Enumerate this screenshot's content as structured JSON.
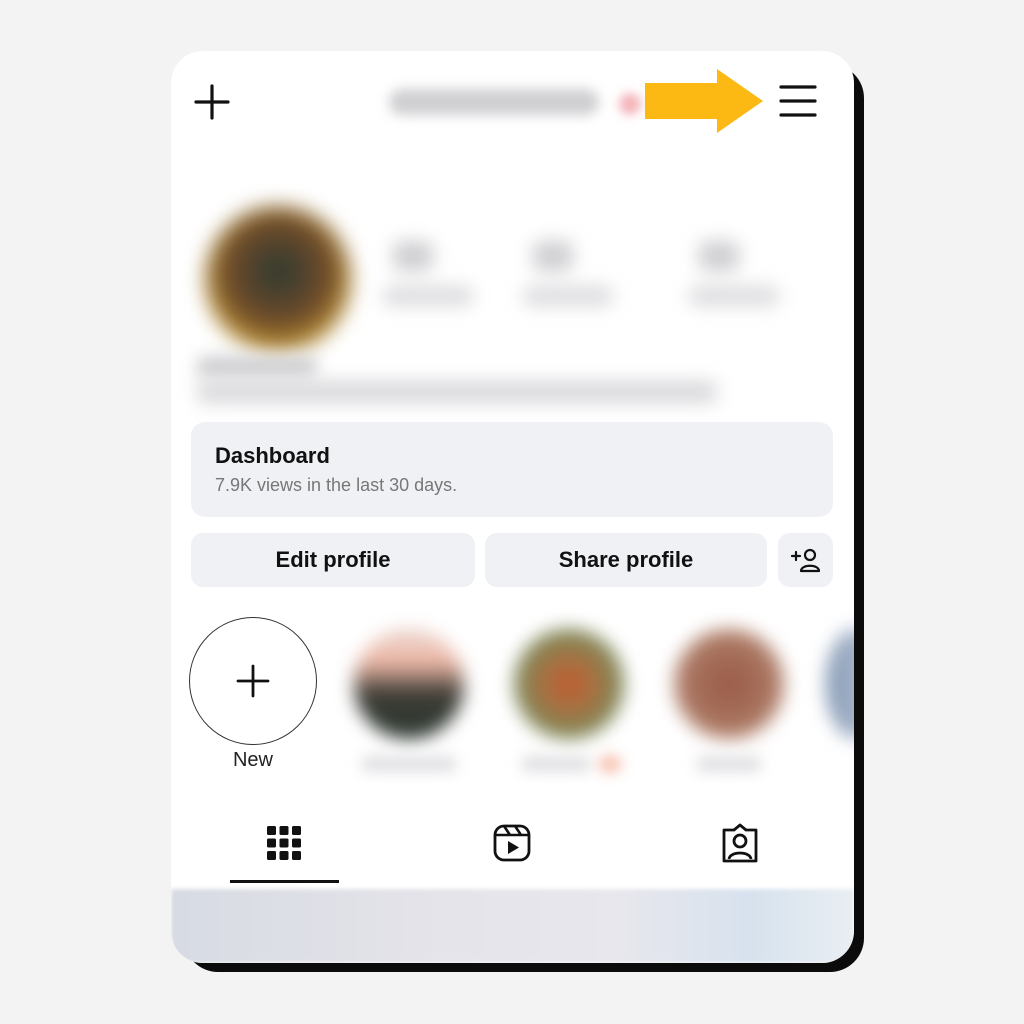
{
  "header": {
    "new_icon": "plus-icon",
    "menu_icon": "hamburger-menu-icon",
    "pointer": {
      "icon": "arrow-right-icon",
      "color": "#FDB913"
    }
  },
  "dashboard": {
    "title": "Dashboard",
    "subtitle": "7.9K views in the last 30 days."
  },
  "actions": {
    "edit_label": "Edit profile",
    "share_label": "Share profile",
    "add_person_icon": "add-person-icon"
  },
  "highlights": {
    "new_label": "New",
    "new_icon": "plus-icon"
  },
  "tabs": [
    {
      "icon": "grid-icon",
      "active": true
    },
    {
      "icon": "reels-icon",
      "active": false
    },
    {
      "icon": "tagged-icon",
      "active": false
    }
  ]
}
